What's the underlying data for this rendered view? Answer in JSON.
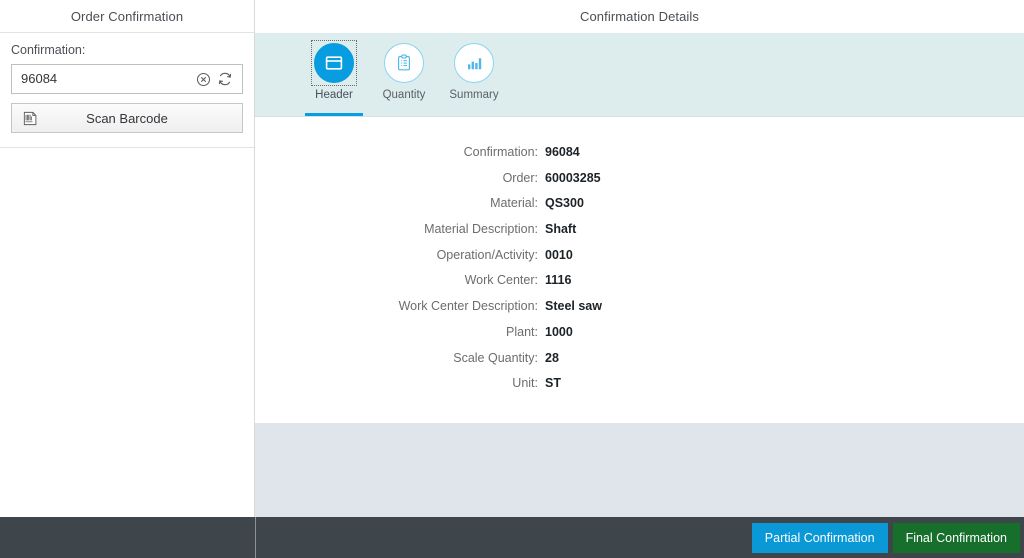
{
  "sidebar": {
    "title": "Order Confirmation",
    "field": {
      "label": "Confirmation:",
      "value": "96084",
      "placeholder": "",
      "clear_icon": "clear-circle-icon",
      "refresh_icon": "refresh-icon"
    },
    "scan_button": {
      "label": "Scan Barcode",
      "icon": "barcode-icon"
    }
  },
  "detail": {
    "title": "Confirmation Details",
    "tabs": [
      {
        "label": "Header",
        "icon": "header-window-icon",
        "selected": true
      },
      {
        "label": "Quantity",
        "icon": "clipboard-icon",
        "selected": false
      },
      {
        "label": "Summary",
        "icon": "bar-chart-icon",
        "selected": false
      }
    ],
    "fields": [
      {
        "label": "Confirmation:",
        "value": "96084"
      },
      {
        "label": "Order:",
        "value": "60003285"
      },
      {
        "label": "Material:",
        "value": "QS300"
      },
      {
        "label": "Material Description:",
        "value": "Shaft"
      },
      {
        "label": "Operation/Activity:",
        "value": "0010"
      },
      {
        "label": "Work Center:",
        "value": "1116"
      },
      {
        "label": "Work Center Description:",
        "value": "Steel saw"
      },
      {
        "label": "Plant:",
        "value": "1000"
      },
      {
        "label": "Scale Quantity:",
        "value": "28"
      },
      {
        "label": "Unit:",
        "value": "ST"
      }
    ]
  },
  "footer": {
    "partial_label": "Partial Confirmation",
    "final_label": "Final Confirmation"
  },
  "colors": {
    "accent_blue": "#089ce0",
    "partial_blue": "#0a98d6",
    "final_green": "#16702c",
    "tabbar_bg": "#ddeced",
    "page_bg": "#dfe5ea",
    "footer_bg": "#3f464b"
  }
}
